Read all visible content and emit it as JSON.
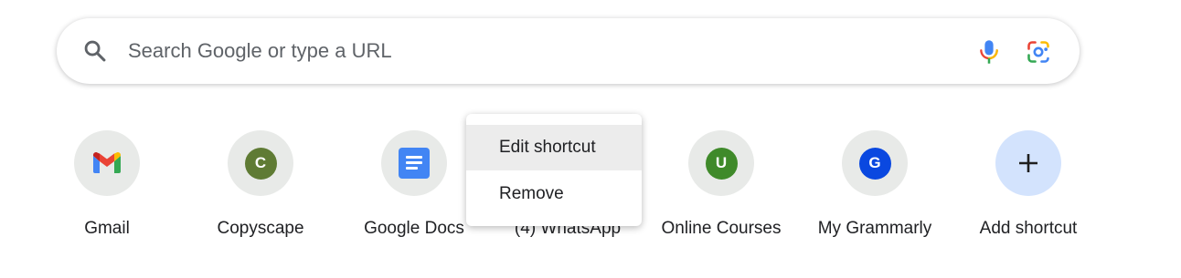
{
  "search": {
    "placeholder": "Search Google or type a URL",
    "icons": [
      "search-icon",
      "microphone-icon",
      "google-lens-icon"
    ]
  },
  "shortcuts": [
    {
      "label": "Gmail",
      "icon": "gmail-icon"
    },
    {
      "label": "Copyscape",
      "icon": "letter-c-icon",
      "letter": "C",
      "color": "#5f7b34"
    },
    {
      "label": "Google Docs",
      "icon": "google-docs-icon"
    },
    {
      "label": "(4) WhatsApp",
      "icon": "whatsapp-icon"
    },
    {
      "label": "Online Courses",
      "icon": "letter-u-icon",
      "letter": "U",
      "color": "#3f8a2a"
    },
    {
      "label": "My Grammarly",
      "icon": "letter-g-icon",
      "letter": "G",
      "color": "#0a48e0"
    },
    {
      "label": "Add shortcut",
      "icon": "plus-icon",
      "symbol": "+"
    }
  ],
  "context_menu": {
    "items": [
      {
        "label": "Edit shortcut"
      },
      {
        "label": "Remove"
      }
    ]
  },
  "colors": {
    "tile_bg": "#e8eae8",
    "add_bg": "#d3e3fd",
    "menu_hover": "#ececec"
  }
}
